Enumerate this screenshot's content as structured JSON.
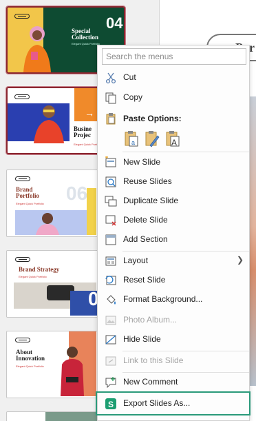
{
  "slides": [
    {
      "title_line1": "Special",
      "title_line2": "Collection",
      "number": "04",
      "subtitle": "Elegant Quick Portfolio"
    },
    {
      "title_line1": "Busine",
      "title_line2": "Projec",
      "subtitle": "Elegant Quick Portfolio"
    },
    {
      "title_line1": "Brand",
      "title_line2": "Portfolio",
      "number": "06",
      "subtitle": "Elegant Quick Portfolio"
    },
    {
      "title_line1": "Brand Strategy",
      "number": "0",
      "subtitle": "Elegant Quick Portfolio"
    },
    {
      "title_line1": "About",
      "title_line2": "Innovation",
      "subtitle": "Elegant Quick Portfolio"
    }
  ],
  "editor": {
    "title_text": "Por"
  },
  "menu": {
    "search_placeholder": "Search the menus",
    "cut": "Cut",
    "copy": "Copy",
    "paste_options": "Paste Options:",
    "new_slide": "New Slide",
    "reuse_slides": "Reuse Slides",
    "duplicate_slide": "Duplicate Slide",
    "delete_slide": "Delete Slide",
    "add_section": "Add Section",
    "layout": "Layout",
    "reset_slide": "Reset Slide",
    "format_background": "Format Background...",
    "photo_album": "Photo Album...",
    "hide_slide": "Hide Slide",
    "link_to_this_slide": "Link to this Slide",
    "new_comment": "New Comment",
    "export_slides_as": "Export Slides As..."
  },
  "colors": {
    "selection_border": "#8b2630",
    "highlight": "#2a9a7a",
    "accent_green": "#0e4b32",
    "accent_orange": "#f08a2a",
    "export_icon_bg": "#1d9e72"
  }
}
